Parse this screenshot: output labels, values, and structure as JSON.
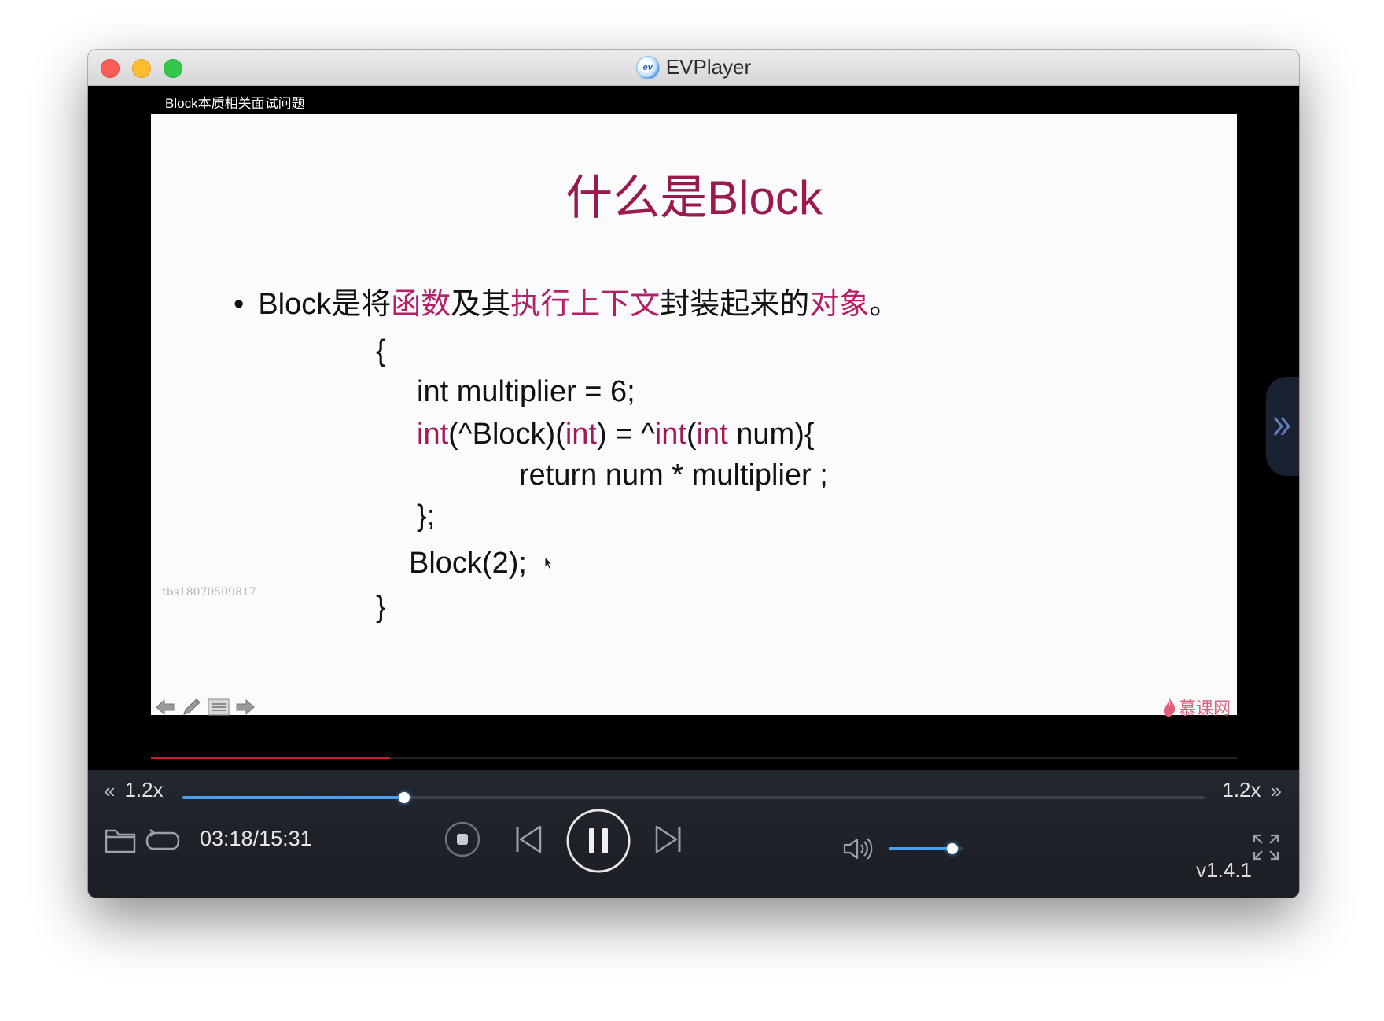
{
  "window": {
    "title": "EVPlayer",
    "logo_text": "ev"
  },
  "video": {
    "caption": "Block本质相关面试问题",
    "progress_fraction": 0.22
  },
  "slide": {
    "title": "什么是Block",
    "bullet": {
      "dot": "•",
      "p1": "Block是将",
      "h1": "函数",
      "p2": "及其",
      "h2": "执行上下文",
      "p3": "封装起来的",
      "h3": "对象",
      "p4": "。"
    },
    "code": {
      "open_brace": "{",
      "line1": "int multiplier = 6;",
      "line2": {
        "kw1": "int",
        "t1": "(^Block)(",
        "kw2": "int",
        "t2": ") = ^",
        "kw3": "int",
        "t3": "(",
        "kw4": "int",
        "t4": " num){"
      },
      "line3": "return num * multiplier ;",
      "line4": "};",
      "line5": "Block(2);",
      "close_brace": "}"
    },
    "watermark_id": "tbs18070509817",
    "brand": "慕课网"
  },
  "controls": {
    "speed_left": "1.2x",
    "speed_right": "1.2x",
    "speed_slider_fraction": 0.217,
    "time": "03:18/15:31",
    "volume_fraction": 0.85,
    "version": "v1.4.1"
  },
  "icons": {
    "folder": "folder-icon",
    "loop": "loop-icon",
    "stop": "stop-icon",
    "prev": "skip-previous-icon",
    "pause": "pause-icon",
    "next": "skip-next-icon",
    "volume": "volume-icon",
    "fullscreen": "fullscreen-icon"
  },
  "colors": {
    "accent_blue": "#4aa0f0",
    "slide_title": "#9b1a4e",
    "highlight": "#b41f68",
    "progress_red": "#d0202c"
  }
}
